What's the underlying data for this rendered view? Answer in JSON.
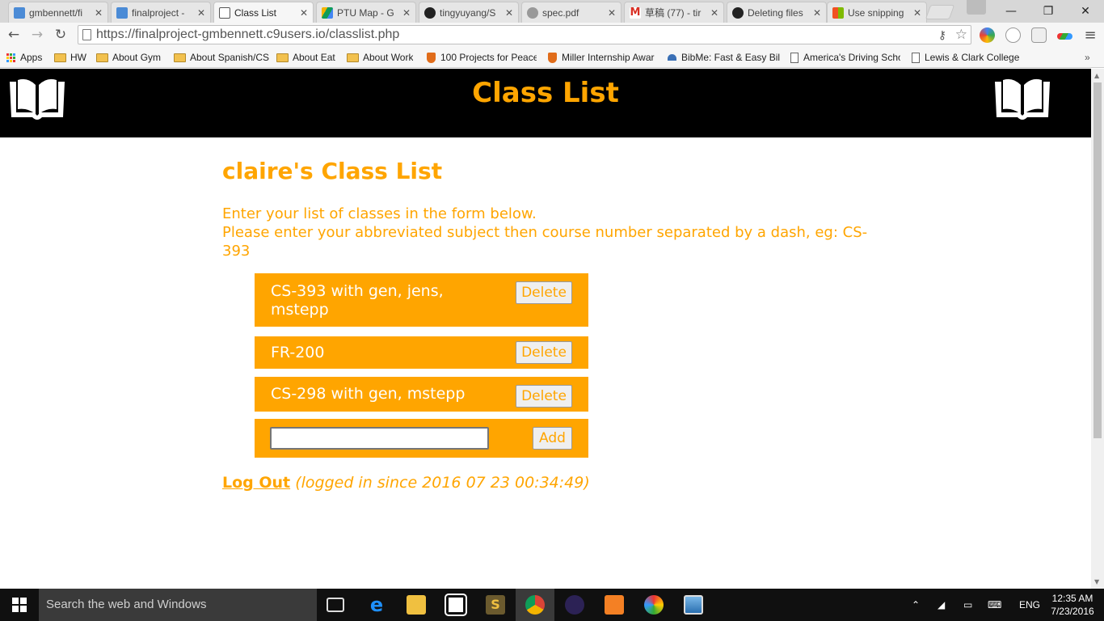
{
  "browser": {
    "tabs": [
      {
        "title": "gmbennett/fi",
        "icon": "cloud9-icon",
        "active": false
      },
      {
        "title": "finalproject -",
        "icon": "cloud9-icon",
        "active": false
      },
      {
        "title": "Class List",
        "icon": "page-icon",
        "active": true
      },
      {
        "title": "PTU Map - G",
        "icon": "drive-icon",
        "active": false
      },
      {
        "title": "tingyuyang/S",
        "icon": "github-icon",
        "active": false
      },
      {
        "title": "spec.pdf",
        "icon": "pdf-icon",
        "active": false
      },
      {
        "title": "草稿 (77) - tir",
        "icon": "gmail-icon",
        "active": false
      },
      {
        "title": "Deleting files",
        "icon": "github-icon",
        "active": false
      },
      {
        "title": "Use snipping",
        "icon": "microsoft-icon",
        "active": false
      }
    ],
    "url": "https://finalproject-gmbennett.c9users.io/classlist.php",
    "bookmarks": [
      {
        "label": "Apps",
        "icon": "apps-grid-icon"
      },
      {
        "label": "HW",
        "icon": "folder-icon"
      },
      {
        "label": "About Gym",
        "icon": "folder-icon"
      },
      {
        "label": "About Spanish/CS",
        "icon": "folder-icon"
      },
      {
        "label": "About Eat",
        "icon": "folder-icon"
      },
      {
        "label": "About Work",
        "icon": "folder-icon"
      },
      {
        "label": "100 Projects for Peace",
        "icon": "shield-icon"
      },
      {
        "label": "Miller Internship Awar",
        "icon": "shield-icon"
      },
      {
        "label": "BibMe: Fast & Easy Bil",
        "icon": "bibme-icon"
      },
      {
        "label": "America's Driving Scho",
        "icon": "page-icon"
      },
      {
        "label": "Lewis & Clark College",
        "icon": "page-icon"
      }
    ]
  },
  "page": {
    "header_title": "Class List",
    "heading": "claire's Class List",
    "instruction_line1": "Enter your list of classes in the form below.",
    "instruction_line2": "Please enter your abbreviated subject then course number separated by a dash, eg: CS-393",
    "classes": [
      {
        "text": "CS-393 with gen, jens, mstepp",
        "button": "Delete"
      },
      {
        "text": "FR-200",
        "button": "Delete"
      },
      {
        "text": "CS-298 with gen, mstepp",
        "button": "Delete"
      }
    ],
    "add_input_value": "",
    "add_button": "Add",
    "logout_label": "Log Out",
    "logged_in_text": "(logged in since 2016 07 23 00:34:49)",
    "accent_color": "#ffa500"
  },
  "taskbar": {
    "search_placeholder": "Search the web and Windows",
    "language": "ENG",
    "time": "12:35 AM",
    "date": "7/23/2016"
  }
}
